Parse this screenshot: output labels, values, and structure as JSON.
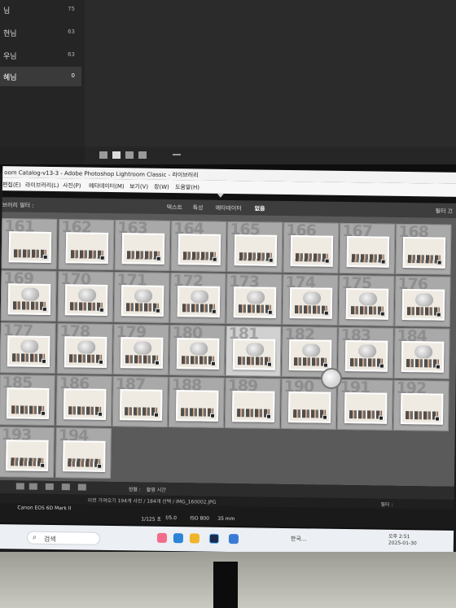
{
  "top_monitor": {
    "folders": [
      {
        "name": "님",
        "count": "75"
      },
      {
        "name": "현님",
        "count": "63"
      },
      {
        "name": "우님",
        "count": "63"
      },
      {
        "name": "혜님",
        "count": "0"
      }
    ]
  },
  "window": {
    "title": "oom Catalog-v13-3 - Adobe Photoshop Lightroom Classic - 라이브러리"
  },
  "menu": [
    "편집(E)",
    "라이브러리(L)",
    "사진(P)",
    "메타데이터(M)",
    "보기(V)",
    "창(W)",
    "도움말(H)"
  ],
  "filter_bar": {
    "left": "브러리 필터 :",
    "tabs": [
      "텍스트",
      "특성",
      "메타데이터",
      "없음"
    ],
    "active": "없음",
    "right": "필터 끄"
  },
  "grid": {
    "rows": [
      [
        "161",
        "162",
        "163",
        "164",
        "165",
        "166",
        "167",
        "168"
      ],
      [
        "169",
        "170",
        "171",
        "172",
        "173",
        "174",
        "175",
        "176"
      ],
      [
        "177",
        "178",
        "179",
        "180",
        "181",
        "182",
        "183",
        "184"
      ],
      [
        "185",
        "186",
        "187",
        "188",
        "189",
        "190",
        "191",
        "192"
      ],
      [
        "193",
        "194"
      ]
    ],
    "selected": "181"
  },
  "toolbar": {
    "sort_label": "정렬 :",
    "sort_value": "촬영 시간"
  },
  "filmstrip": {
    "info": "이전 가져오기 194개 사진 / 184개 선택 / IMG_160002.JPG",
    "right": "필터 :"
  },
  "meta": {
    "camera": "Canon EOS 6D Mark II",
    "exposure": "1/125 초",
    "aperture": "f/5.0",
    "iso": "ISO 800",
    "focal": "35 mm"
  },
  "taskbar": {
    "search": "검색",
    "tray": "한국...",
    "time": "오후 2:51",
    "date": "2025-01-30"
  }
}
